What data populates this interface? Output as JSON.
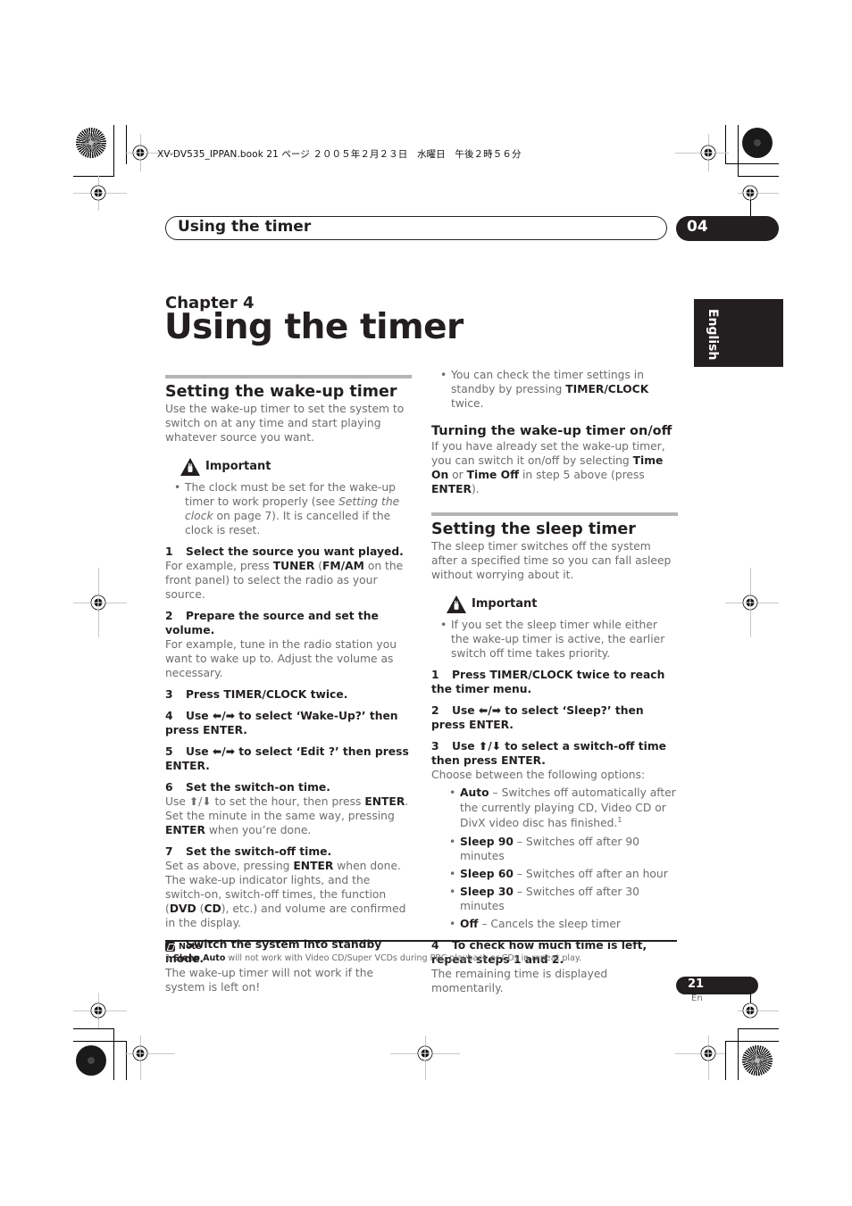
{
  "slug": "XV-DV535_IPPAN.book  21 ページ  ２００５年２月２３日　水曜日　午後２時５６分",
  "header": {
    "title": "Using the timer",
    "chapter_number": "04"
  },
  "side_tab": {
    "language": "English"
  },
  "chapter": {
    "label": "Chapter 4",
    "title": "Using the timer"
  },
  "left_column": {
    "wake_heading": "Setting the wake-up timer",
    "wake_intro": "Use the wake-up timer to set the system to switch on at any time and start playing whatever source you want.",
    "important_label": "Important",
    "important_bullet": {
      "pre": "The clock must be set for the wake-up timer to work properly (see ",
      "italic": "Setting the clock",
      "post": " on page 7). It is cancelled if the clock is reset."
    },
    "steps": [
      {
        "n": "1",
        "title": "Select the source you want played.",
        "body_pre": "For example, press ",
        "k1": "TUNER",
        "mid1": " (",
        "k2": "FM/AM",
        "body_post": " on the front panel) to select the radio as your source."
      },
      {
        "n": "2",
        "title": "Prepare the source and set the volume.",
        "body": "For example, tune in the radio station you want to wake up to. Adjust the volume as necessary."
      },
      {
        "n": "3",
        "title": "Press TIMER/CLOCK twice."
      },
      {
        "n": "4",
        "title": "Use ⬅/➡ to select ‘Wake-Up?’ then press ENTER."
      },
      {
        "n": "5",
        "title": "Use ⬅/➡ to select ‘Edit ?’ then press ENTER."
      },
      {
        "n": "6",
        "title": "Set the switch-on time.",
        "body_a": "Use ⬆/⬇ to set the hour, then press ",
        "k1": "ENTER",
        "body_b": ". Set the minute in the same way, pressing ",
        "k2": "ENTER",
        "body_c": " when you’re done."
      },
      {
        "n": "7",
        "title": "Set the switch-off time.",
        "body_a": "Set as above, pressing ",
        "k1": "ENTER",
        "body_b": " when done. The wake-up indicator lights, and the switch-on, switch-off times, the function (",
        "k2": "DVD",
        "body_c": " (",
        "k3": "CD",
        "body_d": "), etc.) and volume are confirmed in the display."
      },
      {
        "n": "8",
        "title": "Switch the system into standby mode.",
        "body": "The wake-up timer will not work if the system is left on!"
      }
    ]
  },
  "right_column": {
    "check_bullet": {
      "pre": "You can check the timer settings in standby by pressing ",
      "k": "TIMER/CLOCK",
      "post": " twice."
    },
    "onoff_heading": "Turning the wake-up timer on/off",
    "onoff_body": {
      "a": "If you have already set the wake-up timer, you can switch it on/off by selecting ",
      "k1": "Time On",
      "b": " or ",
      "k2": "Time Off",
      "c": " in step 5 above (press ",
      "k3": "ENTER",
      "d": ")."
    },
    "sleep_heading": "Setting the sleep timer",
    "sleep_intro": "The sleep timer switches off the system after a specified time so you can fall asleep without worrying about it.",
    "important_label": "Important",
    "important_bullet": "If you set the sleep timer while either the wake-up timer is active, the earlier switch off time takes priority.",
    "steps": [
      {
        "n": "1",
        "title": "Press TIMER/CLOCK twice to reach the timer menu."
      },
      {
        "n": "2",
        "title": "Use ⬅/➡ to select ‘Sleep?’ then press ENTER."
      },
      {
        "n": "3",
        "title": "Use ⬆/⬇ to select a switch-off time then press ENTER.",
        "body": "Choose between the following options:"
      },
      {
        "n": "4",
        "title": "To check how much time is left, repeat steps 1 and 2.",
        "body": "The remaining time is displayed momentarily."
      }
    ],
    "options": [
      {
        "k": "Auto",
        "text": " – Switches off automatically after the currently playing CD, Video CD or DivX video disc has finished.",
        "sup": "1"
      },
      {
        "k": "Sleep 90",
        "text": " – Switches off after 90 minutes"
      },
      {
        "k": "Sleep 60",
        "text": " – Switches off after an hour"
      },
      {
        "k": "Sleep 30",
        "text": " – Switches off after 30 minutes"
      },
      {
        "k": "Off",
        "text": " – Cancels the sleep timer"
      }
    ]
  },
  "note": {
    "label": "Note",
    "num": "1 ",
    "k": "Sleep Auto",
    "text": " will not work with Video CD/Super VCDs during PBC playback or CDs in repeat play."
  },
  "footer": {
    "page_number": "21",
    "language_code": "En"
  }
}
